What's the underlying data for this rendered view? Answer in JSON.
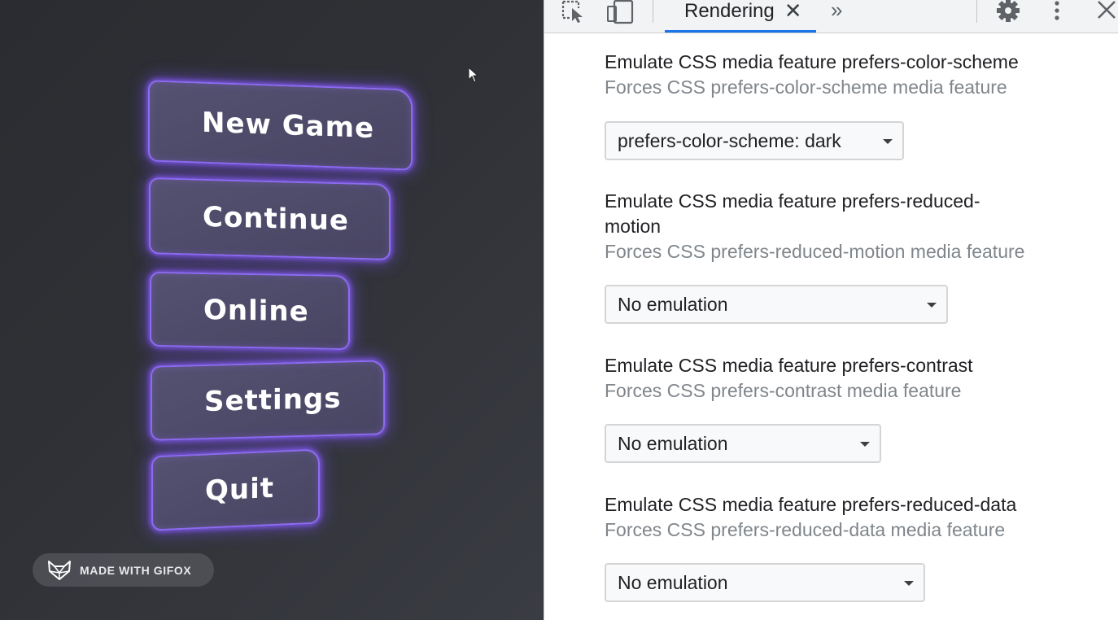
{
  "game": {
    "menu": {
      "new_game": "New Game",
      "continue": "Continue",
      "online": "Online",
      "settings": "Settings",
      "quit": "Quit"
    },
    "watermark": "MADE WITH GIFOX",
    "accent_color": "#8d6bf2"
  },
  "devtools": {
    "toolbar": {
      "inspect_icon": "inspect-element-icon",
      "device_icon": "device-toolbar-icon",
      "active_tab": "Rendering",
      "tab_close": "✕",
      "more_tabs": "»",
      "settings_icon": "gear-icon",
      "menu_icon": "kebab-menu-icon",
      "close": "✕"
    },
    "sections": [
      {
        "title": "Emulate CSS media feature prefers-color-scheme",
        "description": "Forces CSS prefers-color-scheme media feature",
        "selected": "prefers-color-scheme: dark"
      },
      {
        "title_line1": "Emulate CSS media feature prefers-reduced-",
        "title_line2": "motion",
        "description": "Forces CSS prefers-reduced-motion media feature",
        "selected": "No emulation"
      },
      {
        "title": "Emulate CSS media feature prefers-contrast",
        "description": "Forces CSS prefers-contrast media feature",
        "selected": "No emulation"
      },
      {
        "title": "Emulate CSS media feature prefers-reduced-data",
        "description": "Forces CSS prefers-reduced-data media feature",
        "selected": "No emulation"
      }
    ],
    "active_tab_color": "#1a73e8"
  }
}
